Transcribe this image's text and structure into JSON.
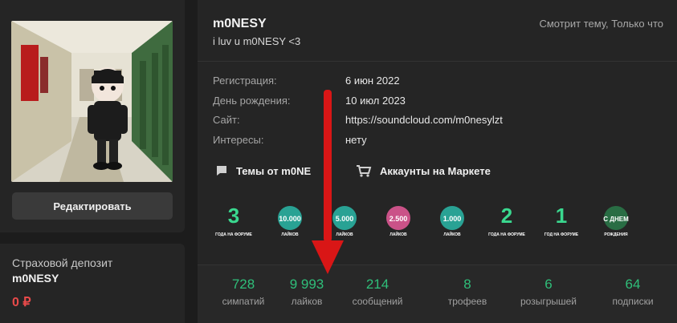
{
  "sidebar": {
    "edit_label": "Редактировать",
    "deposit_title": "Страховой депозит",
    "deposit_name": "m0NESY",
    "deposit_amount": "0 ₽"
  },
  "profile": {
    "username": "m0NESY",
    "status": "i luv u m0NESY <3",
    "viewing": "Смотрит тему, Только что"
  },
  "info": [
    {
      "label": "Регистрация:",
      "value": "6 июн 2022"
    },
    {
      "label": "День рождения:",
      "value": "10 июл 2023"
    },
    {
      "label": "Сайт:",
      "value": "https://soundcloud.com/m0nesylzt"
    },
    {
      "label": "Интересы:",
      "value": "нету"
    }
  ],
  "links": {
    "themes": "Темы от m0NE",
    "market": "Аккаунты на Маркете"
  },
  "trophies": [
    {
      "name": "3-years-trophy",
      "big": "3",
      "sub": "ГОДА НА ФОРУМЕ"
    },
    {
      "name": "10000-likes-trophy",
      "big": "10.000",
      "sub": "ЛАЙКОВ"
    },
    {
      "name": "5000-likes-trophy",
      "big": "5.000",
      "sub": "ЛАЙКОВ"
    },
    {
      "name": "2500-likes-trophy",
      "big": "2.500",
      "sub": "ЛАЙКОВ"
    },
    {
      "name": "1000-likes-trophy",
      "big": "1.000",
      "sub": "ЛАЙКОВ"
    },
    {
      "name": "2-years-trophy",
      "big": "2",
      "sub": "ГОДА НА ФОРУМЕ"
    },
    {
      "name": "1-year-trophy",
      "big": "1",
      "sub": "ГОД НА ФОРУМЕ"
    },
    {
      "name": "birthday-trophy",
      "big": "С ДНЕМ",
      "sub": "РОЖДЕНИЯ"
    }
  ],
  "stats": [
    {
      "value": "728",
      "label": "симпатий"
    },
    {
      "value": "9 993",
      "label": "лайков"
    },
    {
      "value": "214",
      "label": "сообщений"
    },
    {
      "value": "8",
      "label": "трофеев"
    },
    {
      "value": "6",
      "label": "розыгрышей"
    },
    {
      "value": "64",
      "label": "подписки"
    }
  ],
  "colors": {
    "accent_green": "#2fbf7a",
    "deposit_red": "#e84a4a",
    "arrow_red": "#d91616"
  }
}
